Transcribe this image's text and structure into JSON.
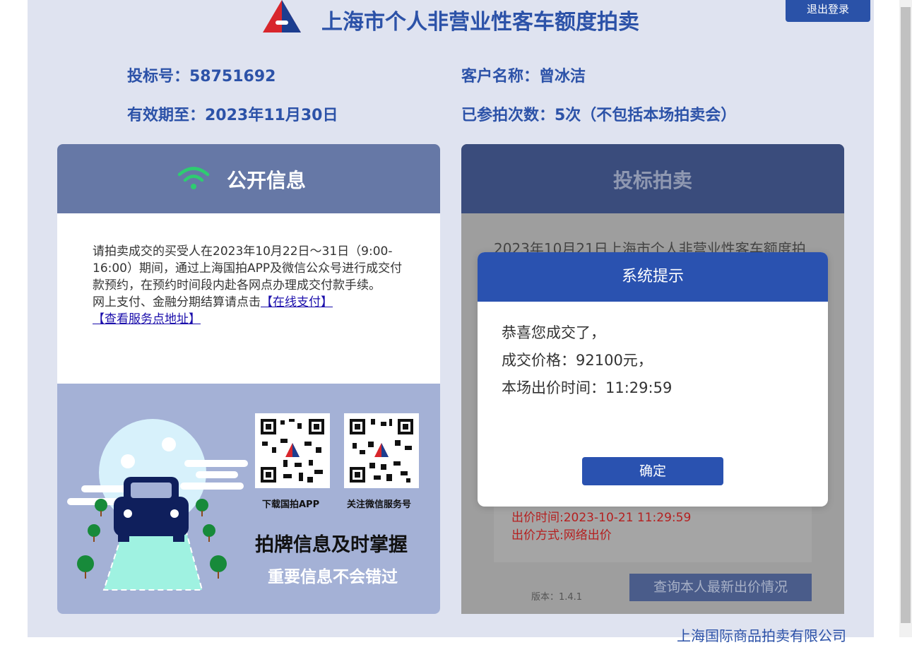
{
  "header": {
    "title": "上海市个人非营业性客车额度拍卖",
    "logout_label": "退出登录"
  },
  "bidder": {
    "bid_number": "投标号：58751692",
    "customer_name": "客户名称：曾冰洁",
    "valid_until": "有效期至：2023年11月30日",
    "auction_count": "已参拍次数：5次（不包括本场拍卖会）"
  },
  "public_info": {
    "title": "公开信息",
    "notice": "请拍卖成交的买受人在2023年10月22日～31日（9:00-16:00）期间，通过上海国拍APP及微信公众号进行成交付款预约，在预约时间段内赴各网点办理成交付款手续。",
    "payment_text": "网上支付、金融分期结算请点击",
    "online_pay_link": "【在线支付】",
    "service_point_link": "【查看服务点地址】",
    "qr_app_caption": "下载国拍APP",
    "qr_wechat_caption": "关注微信服务号",
    "promo_line1": "拍牌信息及时掌握",
    "promo_line2": "重要信息不会错过"
  },
  "bidding": {
    "title": "投标拍卖",
    "auction_text": "2023年10月21日上海市个人非营业性客车额度拍",
    "bid_time": "出价时间:2023-10-21 11:29:59",
    "bid_method": "出价方式:网络出价",
    "version": "版本：1.4.1",
    "query_button": "查询本人最新出价情况"
  },
  "footer": {
    "company": "上海国际商品拍卖有限公司"
  },
  "dialog": {
    "title": "系统提示",
    "line1": "恭喜您成交了，",
    "line2": "成交价格：92100元，",
    "line3": "本场出价时间：11:29:59",
    "ok_button": "确定"
  },
  "colors": {
    "brand_blue": "#2a52b0",
    "title_blue": "#2c52a8",
    "panel_header": "#6678a6",
    "wifi_green": "#2ecc71"
  },
  "icons": [
    "auction-logo-icon",
    "wifi-icon",
    "qr-code-app",
    "qr-code-wechat",
    "car-illustration"
  ]
}
